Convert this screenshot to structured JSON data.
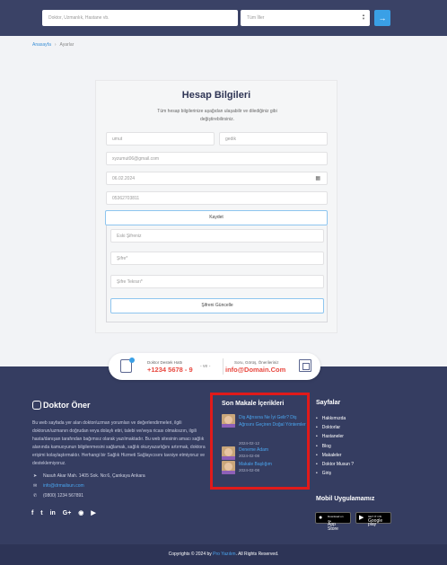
{
  "header": {
    "search_placeholder": "Doktor, Uzmanlık, Hastane vb.",
    "city_placeholder": "Tüm İller",
    "search_button_icon": "arrow-right-icon"
  },
  "breadcrumb": {
    "home": "Anasayfa",
    "separator": "›",
    "current": "Ayarlar"
  },
  "profile": {
    "title": "Hesap Bilgileri",
    "subtitle": "Tüm hesap bilgilerinize aşağıdan ulaşabilir ve dilediğiniz gibi değiştirebilirsiniz.",
    "first_name": "umut",
    "last_name": "gedik",
    "email": "xyzumut06@gmail.com",
    "birth_date": "06.02.2024",
    "phone": "05362703811",
    "save_label": "Kaydet",
    "old_password_placeholder": "Eski Şifreniz",
    "new_password_placeholder": "Şifre*",
    "repeat_password_placeholder": "Şifre Tekrarı*",
    "update_password_label": "Şifreni Güncelle"
  },
  "contact_bar": {
    "hotline_label": "Doktor Destek Hattı",
    "hotline_number": "+1234 5678 - 9",
    "or_label": "- ve -",
    "feedback_label": "Soru, Görüş, Önerileriniz",
    "feedback_email": "info@Domain.Com"
  },
  "footer": {
    "logo_text": "Doktor Öner",
    "description": "Bu web sayfada yer alan doktor/uzman yorumları ve değerlendirmeleri, ilgili doktorun/uzmanın doğrudan veya dolaylı etiri, talebi ve/veya ricası olmaksızın, ilgili hasta/danışan tarafından bağımsız olarak yazılmaktadır. Bu web sitesinin amacı sağlık alanında kamuoyunun bilgilenmesini sağlamak, sağlık okuryazarlığını artırmak, doktora erişimi kolaylaştırmaktır. Herhangi bir Sağlık Hizmeti Sağlayıcısını tavsiye etmiyoruz ve desteklemiyoruz.",
    "address": "Nasuh Akar Mah. 1405 Sok. No:6, Çankaya Ankara",
    "email": "info@drmailsun.com",
    "phone": "(0800) 1234 567891",
    "socials": [
      "f",
      "t",
      "in",
      "G+",
      "rss",
      "yt"
    ],
    "articles_title": "Son Makale İçerikleri",
    "articles": [
      {
        "title": "Diş Ağrısına Ne İyi Gelir? Diş Ağrısını Geçiren Doğal Yöntemler",
        "date": "2024-02-12"
      },
      {
        "title": "Deneme Adam",
        "date": "2024-02-08"
      },
      {
        "title": "Makale Başlığım",
        "date": "2024-02-08"
      }
    ],
    "pages_title": "Sayfalar",
    "pages": [
      "Hakkımızda",
      "Doktorlar",
      "Hastaneler",
      "Blog",
      "Makaleler",
      "Doktor Musun ?",
      "Giriş"
    ],
    "app_title": "Mobil Uygulamamız",
    "app_store": {
      "small": "Download on the",
      "big": "App Store"
    },
    "google_play": {
      "small": "GET IT ON",
      "big": "Google play"
    }
  },
  "copyright": {
    "prefix": "Copyrights © 2024 by",
    "brand": "Pro Yazılım",
    "suffix": ". All Rights Reserved."
  },
  "colors": {
    "header_bg": "#3a4266",
    "footer_bg": "#353d61",
    "accent": "#3aa0e6",
    "highlight": "#e8483f",
    "annotation_box": "#e11a1a"
  }
}
